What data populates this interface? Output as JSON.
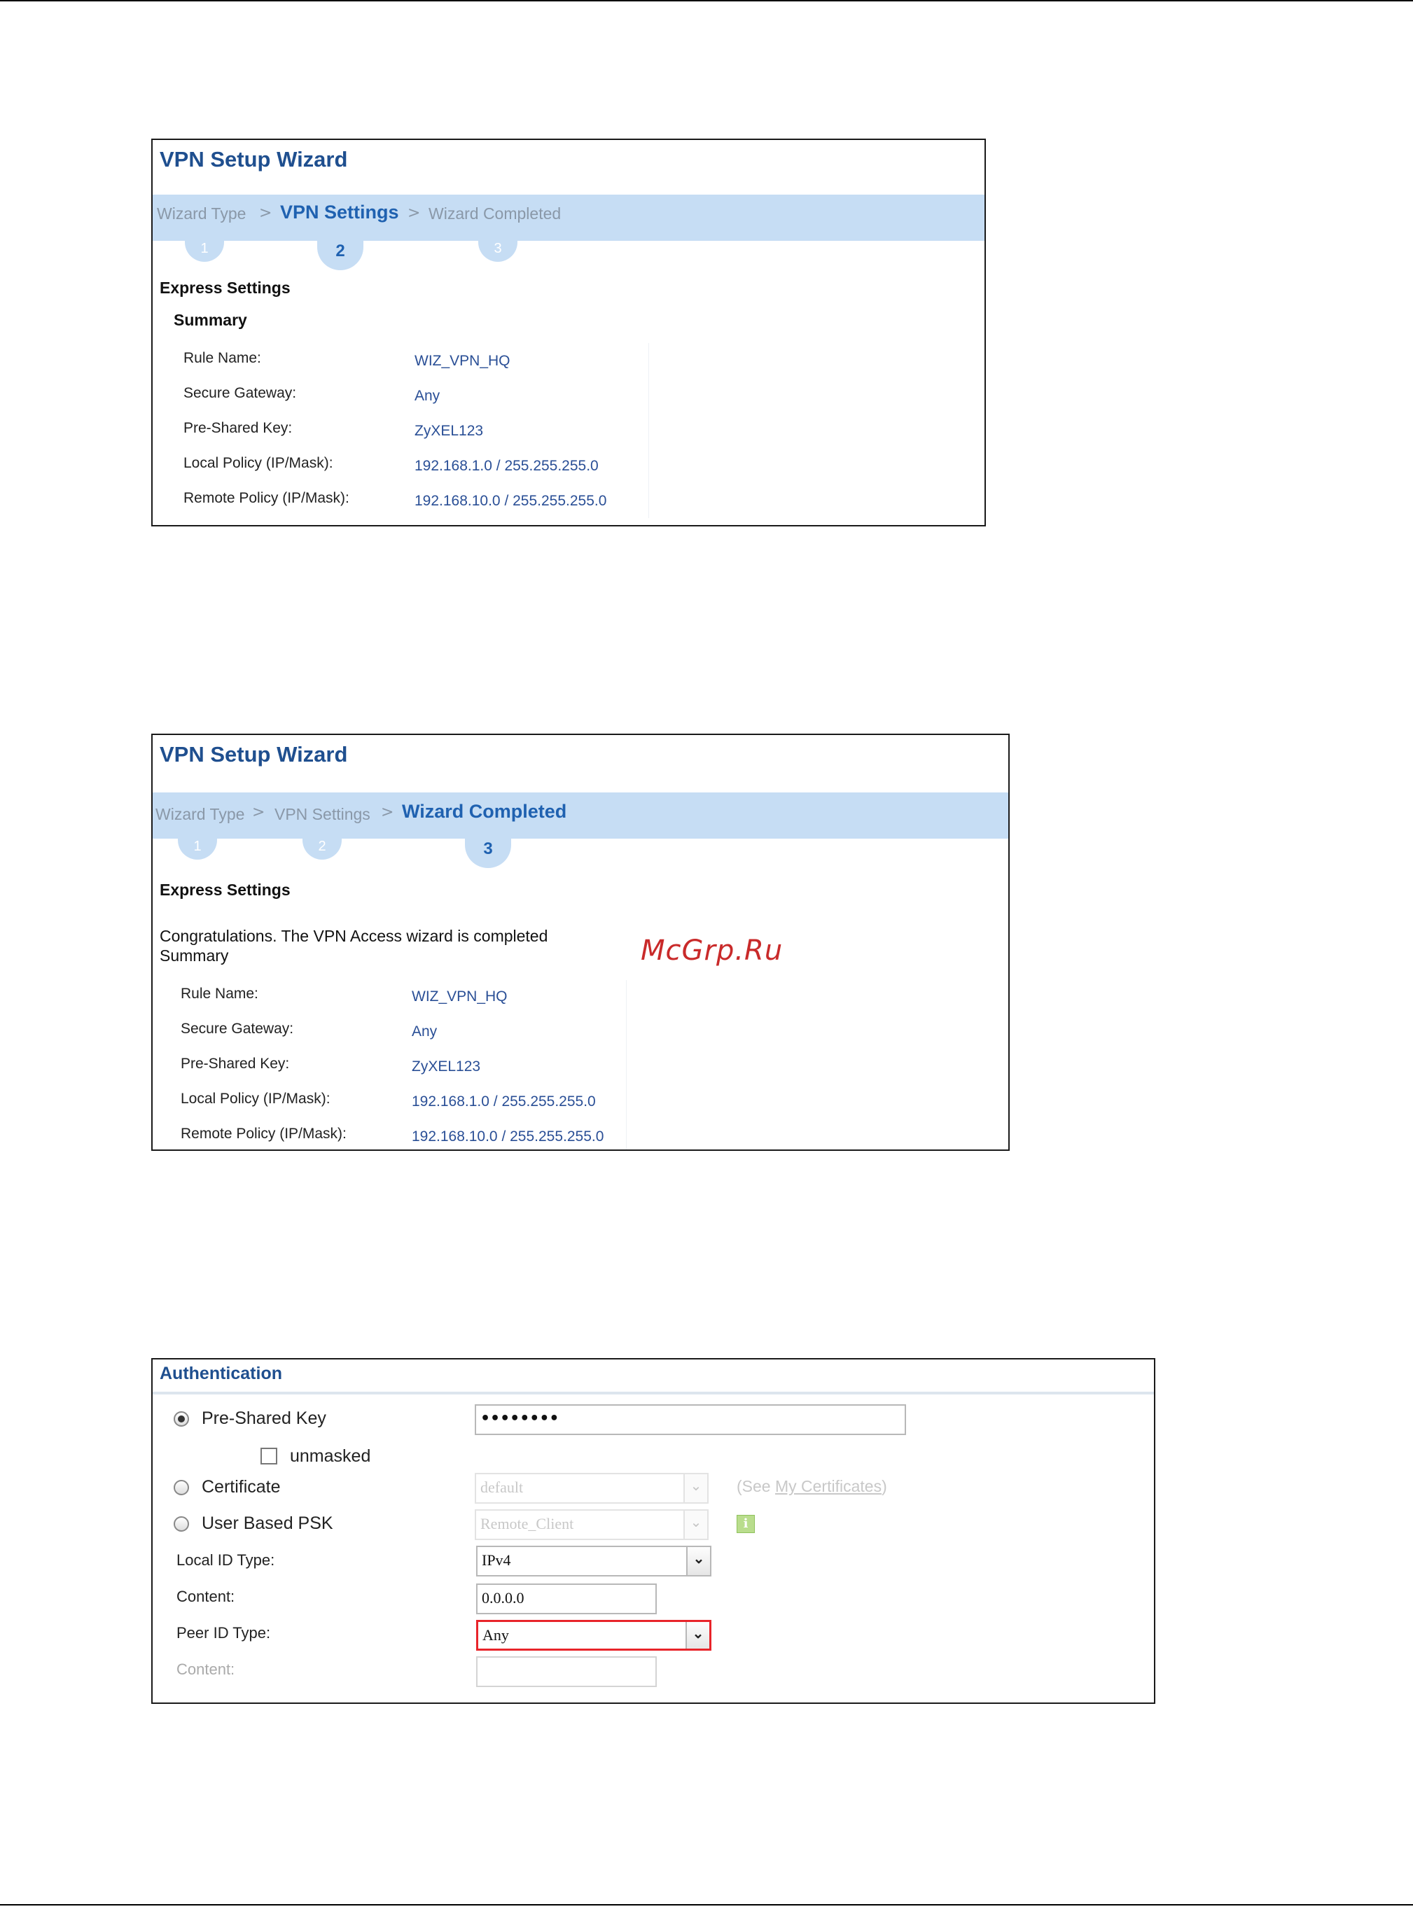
{
  "wizard1": {
    "title": "VPN Setup Wizard",
    "steps": [
      {
        "label": "Wizard Type",
        "num": "1"
      },
      {
        "label": "VPN Settings",
        "num": "2"
      },
      {
        "label": "Wizard Completed",
        "num": "3"
      }
    ],
    "active_step": 2,
    "section_title": "Express Settings",
    "summary_heading": "Summary",
    "rows": [
      {
        "label": "Rule Name:",
        "value": "WIZ_VPN_HQ"
      },
      {
        "label": "Secure Gateway:",
        "value": "Any"
      },
      {
        "label": "Pre-Shared Key:",
        "value": "ZyXEL123"
      },
      {
        "label": "Local Policy (IP/Mask):",
        "value": "192.168.1.0 / 255.255.255.0"
      },
      {
        "label": "Remote Policy (IP/Mask):",
        "value": "192.168.10.0 / 255.255.255.0"
      }
    ]
  },
  "wizard2": {
    "title": "VPN Setup Wizard",
    "steps": [
      {
        "label": "Wizard Type",
        "num": "1"
      },
      {
        "label": "VPN Settings",
        "num": "2"
      },
      {
        "label": "Wizard Completed",
        "num": "3"
      }
    ],
    "active_step": 3,
    "section_title": "Express Settings",
    "congrats": "Congratulations. The VPN Access wizard is completed",
    "summary_heading": "Summary",
    "rows": [
      {
        "label": "Rule Name:",
        "value": "WIZ_VPN_HQ"
      },
      {
        "label": "Secure Gateway:",
        "value": "Any"
      },
      {
        "label": "Pre-Shared Key:",
        "value": "ZyXEL123"
      },
      {
        "label": "Local Policy (IP/Mask):",
        "value": "192.168.1.0 / 255.255.255.0"
      },
      {
        "label": "Remote Policy (IP/Mask):",
        "value": "192.168.10.0 / 255.255.255.0"
      }
    ]
  },
  "watermark": "McGrp.Ru",
  "auth": {
    "title": "Authentication",
    "psk_label": "Pre-Shared Key",
    "psk_value": "••••••••",
    "unmasked_label": "unmasked",
    "certificate_label": "Certificate",
    "certificate_value": "default",
    "see_prefix": "(See ",
    "see_link": "My Certificates",
    "see_suffix": ")",
    "ubpsk_label": "User Based PSK",
    "ubpsk_value": "Remote_Client",
    "info_icon": "info-icon",
    "local_id_type_label": "Local ID Type:",
    "local_id_type_value": "IPv4",
    "content_label": "Content:",
    "content_value": "0.0.0.0",
    "peer_id_type_label": "Peer ID Type:",
    "peer_id_type_value": "Any",
    "peer_content_label": "Content:",
    "peer_content_value": "",
    "highlight_color": "#e8242a",
    "selected_auth": "Pre-Shared Key"
  },
  "colors": {
    "title_blue": "#1f4f8f",
    "step_bar": "#c6ddf4",
    "value_blue": "#2a4f96"
  }
}
